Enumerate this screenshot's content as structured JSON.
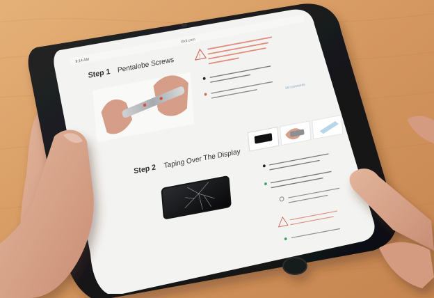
{
  "browser": {
    "status_time": "9:14 AM",
    "url_text": "ifixit.com"
  },
  "guide": {
    "step1": {
      "step_label": "Step 1",
      "title": "Pentalobe Screws",
      "comment_count": "16 comments"
    },
    "step2": {
      "step_label": "Step 2",
      "title": "Taping Over The Display"
    }
  },
  "colors": {
    "wood": "#d59a62",
    "tablet_bezel": "#151617",
    "screen_bg": "#f4f4f2",
    "text_dark": "#333333",
    "warning_red": "#d46d5d",
    "bullet_green": "#42a36b",
    "skin": "#d39f86"
  }
}
